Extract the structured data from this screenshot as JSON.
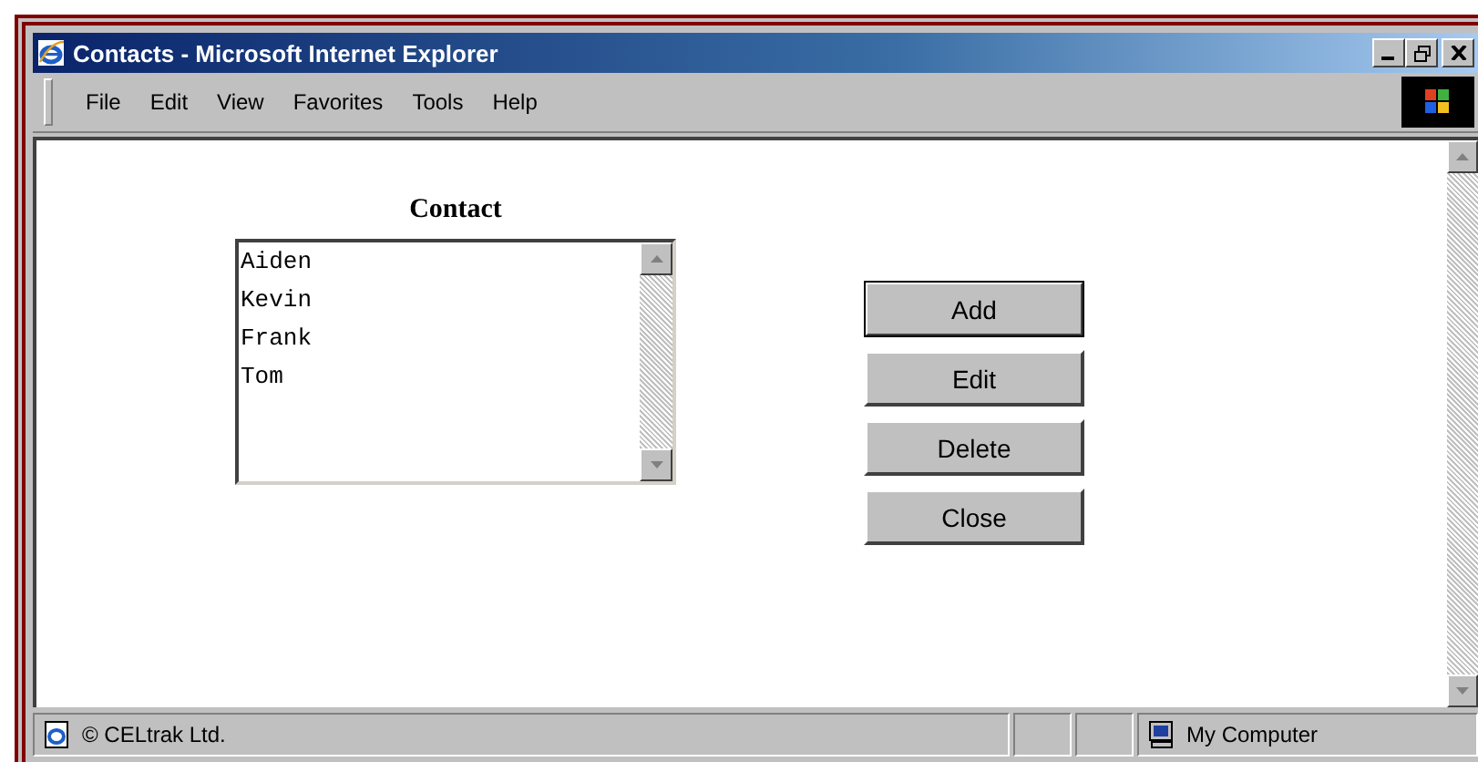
{
  "window": {
    "title": "Contacts - Microsoft Internet Explorer"
  },
  "menu": [
    "File",
    "Edit",
    "View",
    "Favorites",
    "Tools",
    "Help"
  ],
  "form": {
    "heading": "Contact",
    "contacts": [
      {
        "name": "Aiden",
        "selected": false
      },
      {
        "name": "Kevin",
        "selected": false
      },
      {
        "name": "Frank",
        "selected": false
      },
      {
        "name": "Tom",
        "selected": false
      }
    ],
    "buttons": [
      {
        "label": "Add",
        "default": true
      },
      {
        "label": "Edit",
        "default": false
      },
      {
        "label": "Delete",
        "default": false
      },
      {
        "label": "Close",
        "default": false
      }
    ]
  },
  "status_bar": {
    "text": "© CELtrak Ltd.",
    "zone": "My Computer"
  }
}
